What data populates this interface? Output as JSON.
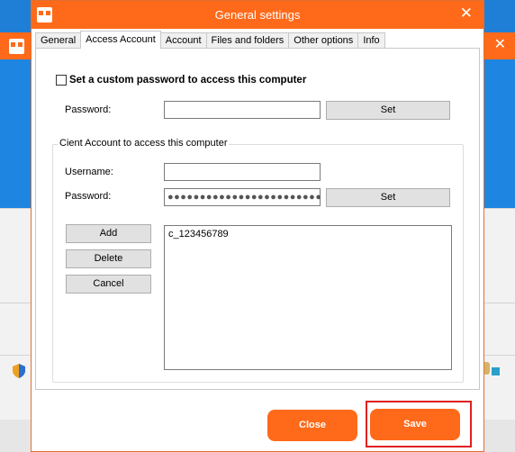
{
  "dialog": {
    "title": "General settings",
    "close_glyph": "✕",
    "tabs": [
      {
        "label": "General",
        "active": false
      },
      {
        "label": "Access Account",
        "active": true
      },
      {
        "label": "Account",
        "active": false
      },
      {
        "label": "Files and folders",
        "active": false
      },
      {
        "label": "Other options",
        "active": false
      },
      {
        "label": "Info",
        "active": false
      }
    ],
    "custom_password": {
      "checkbox_label": "Set a custom password to access this computer",
      "checked": false,
      "password_label": "Password:",
      "password_value": "",
      "set_label": "Set"
    },
    "client_account": {
      "group_title": "Cient Account to access this computer",
      "username_label": "Username:",
      "username_value": "",
      "password_label": "Password:",
      "password_masked": "●●●●●●●●●●●●●●●●●●●●●●●●●",
      "set_label": "Set",
      "add_label": "Add",
      "delete_label": "Delete",
      "cancel_label": "Cancel",
      "accounts": [
        "c_123456789"
      ]
    },
    "footer": {
      "close_label": "Close",
      "save_label": "Save"
    }
  },
  "background_app": {
    "close_glyph": "✕"
  },
  "colors": {
    "accent_orange": "#ff6a1a",
    "desktop_blue": "#1f7fd6",
    "highlight_red": "#e02020"
  }
}
